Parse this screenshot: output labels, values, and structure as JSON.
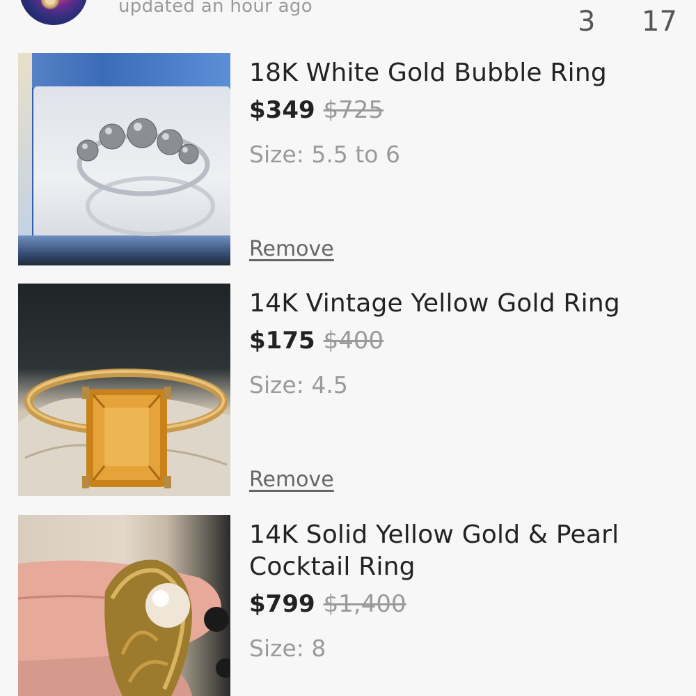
{
  "header": {
    "updated_text": "updated an hour ago",
    "count_a": "3",
    "count_b": "17"
  },
  "items": [
    {
      "title": "18K White Gold Bubble Ring",
      "price": "$349",
      "original_price": "$725",
      "size_label": "Size:",
      "size_value": "5.5 to 6",
      "remove_label": "Remove"
    },
    {
      "title": "14K Vintage Yellow Gold Ring",
      "price": "$175",
      "original_price": "$400",
      "size_label": "Size:",
      "size_value": "4.5",
      "remove_label": "Remove"
    },
    {
      "title_line1": "14K Solid Yellow Gold & Pearl",
      "title_line2": "Cocktail Ring",
      "price": "$799",
      "original_price": "$1,400",
      "size_label": "Size:",
      "size_value": "8"
    }
  ]
}
